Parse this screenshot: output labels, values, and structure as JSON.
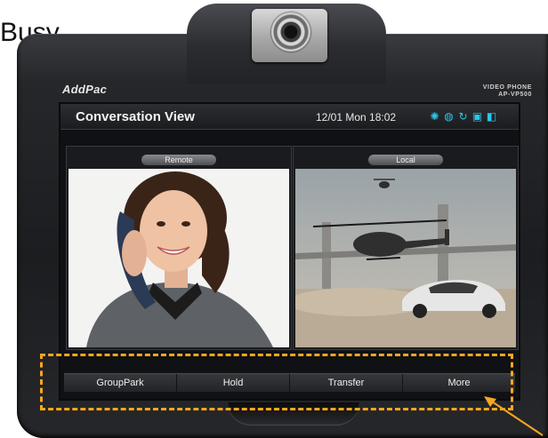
{
  "status_label": "Busy",
  "device": {
    "brand": "AddPac",
    "model_line1": "VIDEO PHONE",
    "model_line2": "AP-VP500"
  },
  "screen": {
    "title": "Conversation View",
    "datetime": "12/01 Mon 18:02",
    "status_icons": [
      "settings-icon",
      "globe-icon",
      "sync-icon",
      "calendar-icon",
      "phonebook-icon"
    ]
  },
  "panels": {
    "remote_label": "Remote",
    "local_label": "Local"
  },
  "softkeys": [
    "GroupPark",
    "Hold",
    "Transfer",
    "More"
  ],
  "annotation": {
    "highlight_color": "#f5a623"
  }
}
